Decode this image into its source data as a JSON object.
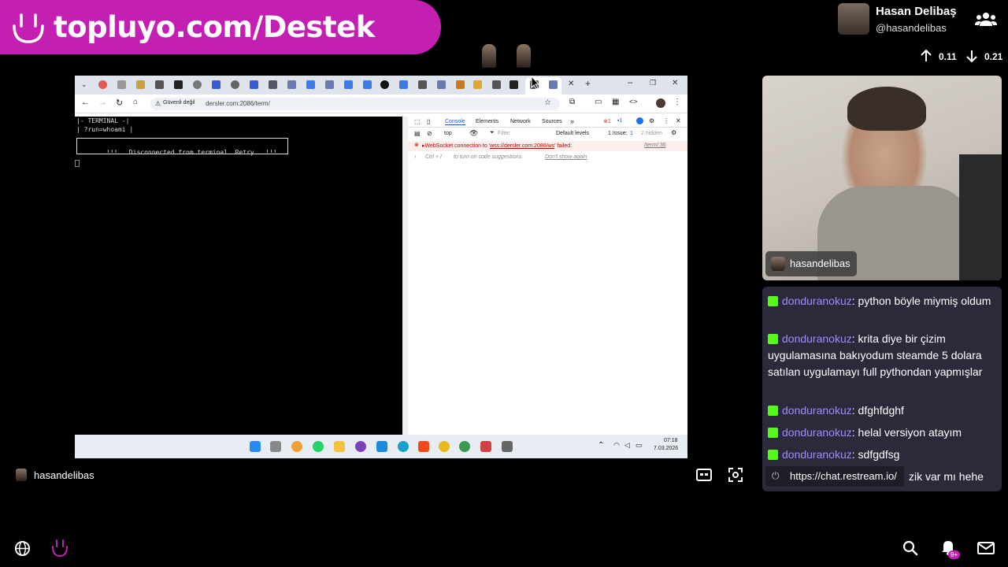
{
  "banner": {
    "text": "topluyo.com/Destek"
  },
  "profile": {
    "name": "Hasan Delibaş",
    "handle": "@hasandelibas"
  },
  "stats": {
    "up": "0.11",
    "down": "0.21"
  },
  "browser": {
    "url": "dersler.com:2086/term/",
    "security_label": "Güvenli değil",
    "terminal": {
      "line1": "|- TERMINAL -|",
      "line2": "| ?run=whoami |",
      "disconnected": "!!!   Disconnected from terminal. Retry   !!!"
    },
    "devtools": {
      "tabs": [
        "Console",
        "Elements",
        "Network",
        "Sources"
      ],
      "filter_placeholder": "Filter",
      "top_select": "top",
      "levels": "Default levels",
      "issue": "1 Issue:",
      "issue_count": "1",
      "hidden": "2 hidden",
      "error_prefix": "WebSocket connection to '",
      "error_url": "wss://dersler.com:2086/ws",
      "error_suffix": "' failed:",
      "error_src": "/term/:36",
      "hint_key": "Ctrl + I",
      "hint_text": "to turn on code suggestions.",
      "hint_link": "Don't show again",
      "badge_errors": "1",
      "badge_msgs": "1"
    },
    "taskbar": {
      "time": "07:18",
      "date": "7.03.2026"
    }
  },
  "webcam": {
    "label": "hasandelibas"
  },
  "chat": {
    "messages": [
      {
        "user": "donduranokuz",
        "text": "python böyle miymiş oldum"
      },
      {
        "user": "donduranokuz",
        "text": "krita diye bir çizim uygulamasına bakıyodum steamde 5 dolara satılan uygulamayı full pythondan yapmışlar"
      },
      {
        "user": "donduranokuz",
        "text": "dfghfdghf"
      },
      {
        "user": "donduranokuz",
        "text": "helal versiyon atayım"
      },
      {
        "user": "donduranokuz",
        "text": "sdfgdfsg"
      }
    ],
    "partial_text": "zik var mı hehe",
    "url_pill": "https://chat.restream.io/"
  },
  "bottom": {
    "username": "hasandelibas",
    "notif_badge": "9+"
  },
  "colors": {
    "banner": "#c41fb3",
    "chat_bg": "#2b2a3a",
    "chat_user": "#9e8cff",
    "kick_green": "#53fc18"
  }
}
